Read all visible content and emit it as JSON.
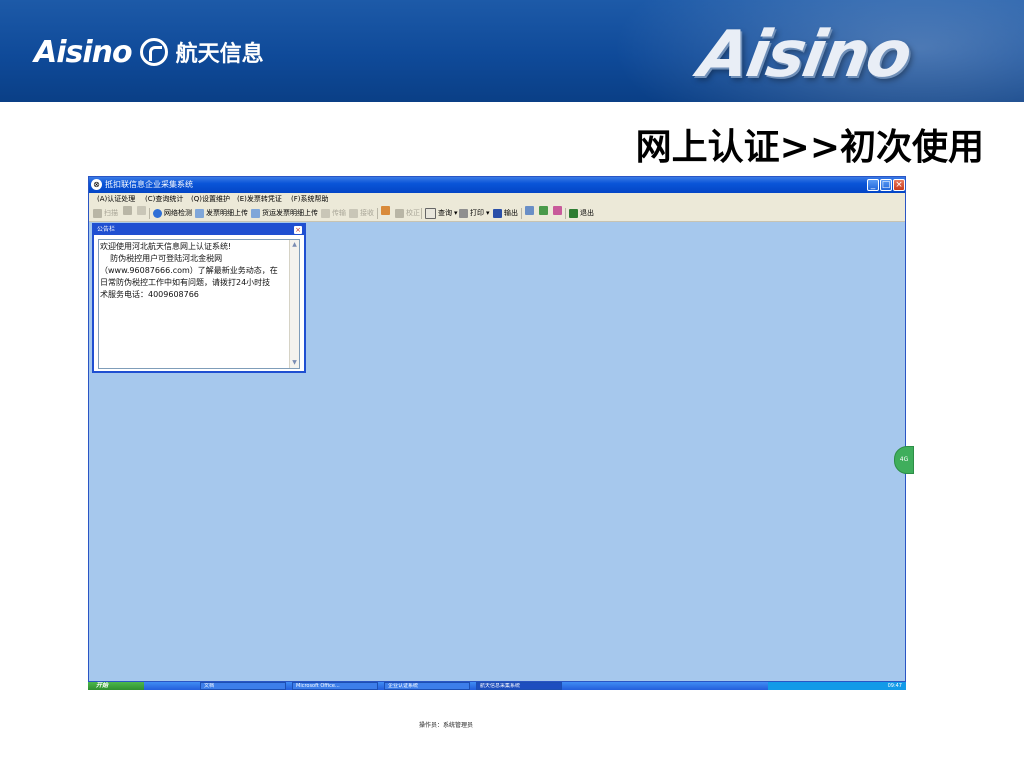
{
  "banner": {
    "brand_latin": "Aisino",
    "brand_cn": "航天信息",
    "brand_large": "Aisino"
  },
  "slide": {
    "title": "网上认证>>初次使用"
  },
  "window": {
    "title": "抵扣联信息企业采集系统",
    "min_glyph": "_",
    "max_glyph": "□",
    "close_glyph": "×",
    "menu": [
      "(A)认证处理",
      "(C)查询统计",
      "(Q)设置维护",
      "(E)发票转凭证",
      "(F)系统帮助"
    ],
    "toolbar": {
      "scan": "扫描",
      "network_check": "网络检测",
      "invoice_upload": "发票明细上传",
      "goods_invoice_upload": "货运发票明细上传",
      "send": "传输",
      "receive": "接收",
      "correct": "校正",
      "query": "查询",
      "print": "打印",
      "export": "输出",
      "exit": "退出"
    },
    "notice": {
      "title": "公告栏",
      "close_glyph": "×",
      "lines": [
        "欢迎使用河北航天信息网上认证系统!",
        "    防伪税控用户可登陆河北金税网",
        "（www.96087666.com）了解最新业务动态，在",
        "日常防伪税控工作中如有问题，请拨打24小时技",
        "术服务电话：4009608766"
      ]
    },
    "side_knob": "4G",
    "status_text": "操作员：系统管理员"
  },
  "taskbar": {
    "start": "开始",
    "tasks": [
      "文档",
      "Microsoft Office...",
      "企业认证系统",
      "航天信息采集系统"
    ],
    "clock": "09:47"
  },
  "colors": {
    "banner_blue": "#0f4a99",
    "window_client": "#a6c8ed",
    "xp_title": "#0a55d8",
    "notice_border": "#1f4fd1"
  }
}
